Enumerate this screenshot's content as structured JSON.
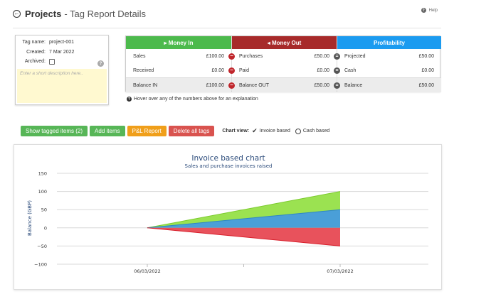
{
  "header": {
    "title": "Projects",
    "subtitle": "- Tag Report Details",
    "help_label": "Help"
  },
  "tag": {
    "name_label": "Tag name:",
    "name_value": "project-001",
    "created_label": "Created:",
    "created_value": "7 Mar 2022",
    "archived_label": "Archived:",
    "description_placeholder": "Enter a short description here.."
  },
  "money": {
    "money_in": {
      "header": "Money In",
      "rows": [
        {
          "label": "Sales",
          "value": "£100.00"
        },
        {
          "label": "Received",
          "value": "£0.00"
        }
      ],
      "total": {
        "label": "Balance IN",
        "value": "£100.00"
      }
    },
    "money_out": {
      "header": "Money Out",
      "rows": [
        {
          "label": "Purchases",
          "value": "£50.00"
        },
        {
          "label": "Paid",
          "value": "£0.00"
        }
      ],
      "total": {
        "label": "Balance OUT",
        "value": "£50.00"
      }
    },
    "profitability": {
      "header": "Profitability",
      "rows": [
        {
          "label": "Projected",
          "value": "£50.00"
        },
        {
          "label": "Cash",
          "value": "£0.00"
        }
      ],
      "total": {
        "label": "Balance",
        "value": "£50.00"
      }
    },
    "colors": {
      "in": "#4cba4c",
      "out": "#a72a2a",
      "profit": "#1b9bf0"
    }
  },
  "hover_note": "Hover over any of the numbers above for an explanation",
  "buttons": {
    "show_tagged": "Show tagged items (2)",
    "add_items": "Add items",
    "pl_report": "P&L Report",
    "delete_tags": "Delete all tags"
  },
  "chart_view": {
    "label": "Chart view:",
    "option_invoice": "Invoice based",
    "option_cash": "Cash based",
    "selected": "Invoice based"
  },
  "chart_data": {
    "type": "area",
    "title": "Invoice based chart",
    "subtitle": "Sales and purchase invoices raised",
    "xlabel": "",
    "ylabel": "Balance (GBP)",
    "categories": [
      "06/03/2022",
      "07/03/2022"
    ],
    "ylim": [
      -100,
      150
    ],
    "yticks": [
      150,
      100,
      50,
      0,
      -50,
      -100
    ],
    "series": [
      {
        "values": [
          0,
          100
        ],
        "color": "#9be251"
      },
      {
        "values": [
          0,
          50
        ],
        "color": "#4a9fd8"
      },
      {
        "values": [
          0,
          -50
        ],
        "color": "#e8525c"
      }
    ],
    "grid": true,
    "legend": "none"
  }
}
